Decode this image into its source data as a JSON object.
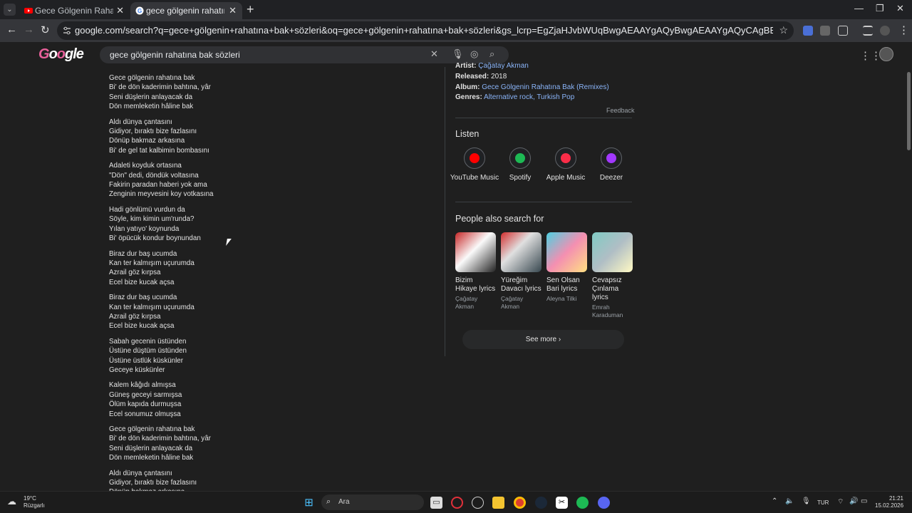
{
  "browser": {
    "tabs": [
      {
        "title": "Gece Gölgenin Rahatına Ba",
        "active": false
      },
      {
        "title": "gece gölgenin rahatına bak söz",
        "active": true
      }
    ],
    "url": "google.com/search?q=gece+gölgenin+rahatına+bak+sözleri&oq=gece+gölgenin+rahatına+bak+sözleri&gs_lcrp=EgZjaHJvbWUqBwgAEAAYgAQyBwgAEAAYgAQyCAgBEAAYFhgeMggIAhAAGBYYHjIICAMQABgWGB4yCAgEEAAYFhgeMgc"
  },
  "google": {
    "logo_text": "Google",
    "query": "gece gölgenin rahatına bak sözleri"
  },
  "lyrics": {
    "stanzas": [
      [
        "Gece gölgenin rahatına bak",
        "Bi' de dön kaderimin bahtına, yâr",
        "Seni düşlerin anlayacak da",
        "Dön memleketin hâline bak"
      ],
      [
        "Aldı dünya çantasını",
        "Gidiyor, bıraktı bize fazlasını",
        "Dönüp bakmaz arkasına",
        "Bi' de gel tat kalbimin bombasını"
      ],
      [
        "Adaleti koyduk ortasına",
        "\"Dön\" dedi, döndük voltasına",
        "Fakirin paradan haberi yok ama",
        "Zenginin meyvesini koy votkasına"
      ],
      [
        "Hadi gönlümü vurdun da",
        "Söyle, kim kimin um'runda?",
        "Yılan yatıyo' koynunda",
        "Bi' öpücük kondur boynundan"
      ],
      [
        "Biraz dur baş ucumda",
        "Kan ter kalmışım uçurumda",
        "Azrail göz kırpsa",
        "Ecel bize kucak açsa"
      ],
      [
        "Biraz dur baş ucumda",
        "Kan ter kalmışım uçurumda",
        "Azrail göz kırpsa",
        "Ecel bize kucak açsa"
      ],
      [
        "Sabah gecenin üstünden",
        "Üstüne düştüm üstünden",
        "Üstüne üstlük küskünler",
        "Geceye küskünler"
      ],
      [
        "Kalem kâğıdı almışsa",
        "Güneş geceyi sarmışsa",
        "Ölüm kapıda durmuşsa",
        "Ecel sonumuz olmuşsa"
      ],
      [
        "Gece gölgenin rahatına bak",
        "Bi' de dön kaderimin bahtına, yâr",
        "Seni düşlerin anlayacak da",
        "Dön memleketin hâline bak"
      ],
      [
        "Aldı dünya çantasını",
        "Gidiyor, bıraktı bize fazlasını",
        "Dönüp bakmaz arkasına"
      ]
    ]
  },
  "panel": {
    "artist_label": "Artist:",
    "artist": "Çağatay Akman",
    "released_label": "Released:",
    "released": "2018",
    "album_label": "Album:",
    "album": "Gece Gölgenin Rahatına Bak (Remixes)",
    "genres_label": "Genres:",
    "genres": "Alternative rock, Turkish Pop",
    "feedback": "Feedback",
    "listen_title": "Listen",
    "listen": [
      {
        "name": "YouTube Music",
        "icon": "youtube-music-icon",
        "color": "#ff0000"
      },
      {
        "name": "Spotify",
        "icon": "spotify-icon",
        "color": "#1db954"
      },
      {
        "name": "Apple Music",
        "icon": "apple-music-icon",
        "color": "#fa2d48"
      },
      {
        "name": "Deezer",
        "icon": "deezer-icon",
        "color": "#a238ff"
      }
    ],
    "pas_title": "People also search for",
    "pas": [
      {
        "title": "Bizim Hikaye lyrics",
        "artist": "Çağatay Akman"
      },
      {
        "title": "Yüreğim Davacı lyrics",
        "artist": "Çağatay Akman"
      },
      {
        "title": "Sen Olsan Bari lyrics",
        "artist": "Aleyna Tilki"
      },
      {
        "title": "Cevapsız Çınlama lyrics",
        "artist": "Emrah Karaduman"
      }
    ],
    "see_more": "See more"
  },
  "taskbar": {
    "weather_temp": "19°C",
    "weather_desc": "Rüzgarlı",
    "search_placeholder": "Ara",
    "language": "TUR",
    "time": "21:21",
    "date": "15.02.2026"
  }
}
